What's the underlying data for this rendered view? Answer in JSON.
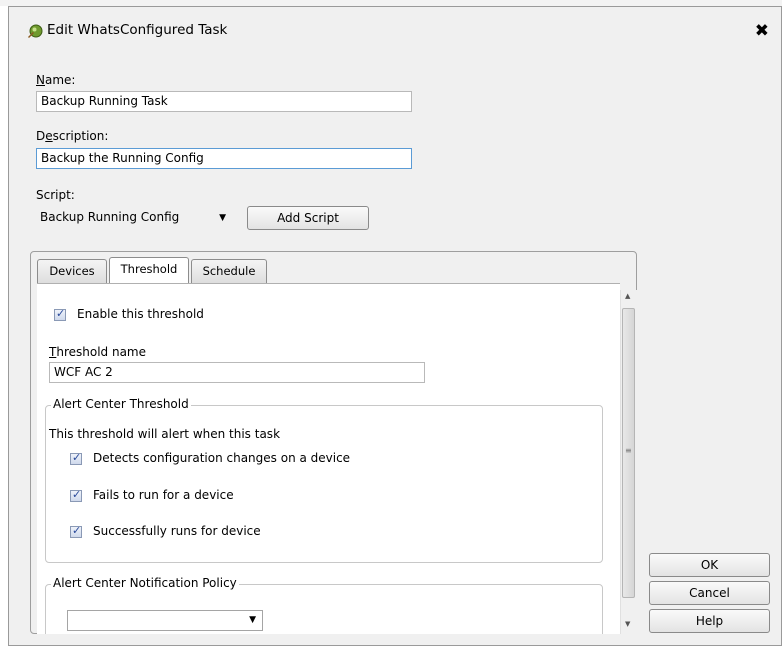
{
  "dialog": {
    "title": "Edit WhatsConfigured Task",
    "close_symbol": "✖"
  },
  "form": {
    "name_label_u": "N",
    "name_label_rest": "ame:",
    "name_value": "Backup Running Task",
    "description_label_pre": "D",
    "description_label_u": "e",
    "description_label_rest": "scription:",
    "description_value": "Backup the Running Config",
    "script_label": "Script:",
    "script_value": "Backup Running Config",
    "add_script_label": "Add Script"
  },
  "tabs": [
    {
      "label": "Devices",
      "active": false
    },
    {
      "label": "Threshold",
      "active": true
    },
    {
      "label": "Schedule",
      "active": false
    }
  ],
  "threshold": {
    "enable_label": "Enable this threshold",
    "enable_checked": true,
    "name_label_u": "T",
    "name_label_rest": "hreshold name",
    "name_value": "WCF AC 2",
    "alert_group_title": "Alert Center Threshold",
    "alert_intro": "This threshold will alert when this task",
    "conditions": [
      {
        "label": "Detects configuration changes on a device",
        "checked": true
      },
      {
        "label": "Fails to run for a device",
        "checked": true
      },
      {
        "label": "Successfully runs for device",
        "checked": true
      }
    ],
    "policy_group_title": "Alert Center Notification Policy",
    "policy_value": ""
  },
  "buttons": {
    "ok": "OK",
    "cancel": "Cancel",
    "help": "Help"
  },
  "icons": {
    "title": "whatsconfigured-app-icon",
    "dropdown": "▼",
    "scroll_up": "▲",
    "scroll_down": "▼",
    "scroll_grip": "≡"
  }
}
